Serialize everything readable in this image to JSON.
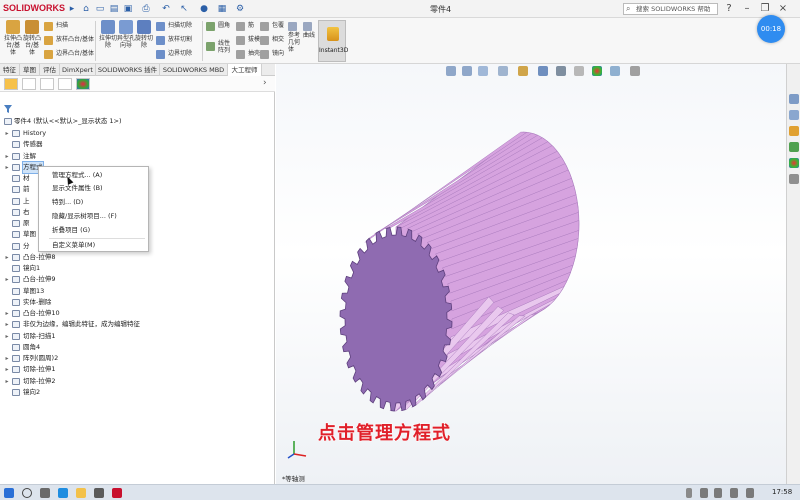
{
  "app": {
    "brand": "SOLIDWORKS",
    "doc_title": "零件4",
    "search_placeholder": "搜索 SOLIDWORKS 帮助"
  },
  "ribbon": {
    "big_buttons": [
      {
        "label": "拉伸凸台/基体",
        "color": "#d9a441"
      },
      {
        "label": "旋转凸台/基体",
        "color": "#c98f35"
      },
      {
        "label": "拉伸切除",
        "color": "#6d8fc9"
      },
      {
        "label": "异型孔向导",
        "color": "#7a9bd2"
      },
      {
        "label": "旋转切除",
        "color": "#5d7fbf"
      }
    ],
    "small_buttons": [
      {
        "label": "扫描",
        "color": "#d9a441"
      },
      {
        "label": "放样凸台/基体",
        "color": "#d9a441"
      },
      {
        "label": "边界凸台/基体",
        "color": "#d9a441"
      },
      {
        "label": "扫描切除",
        "color": "#6d8fc9"
      },
      {
        "label": "放样切割",
        "color": "#6d8fc9"
      },
      {
        "label": "边界切除",
        "color": "#6d8fc9"
      },
      {
        "label": "圆角",
        "color": "#7ca36d"
      },
      {
        "label": "线性阵列",
        "color": "#7ca36d"
      },
      {
        "label": "筋",
        "color": "#a0a0a0"
      },
      {
        "label": "拔模",
        "color": "#a0a0a0"
      },
      {
        "label": "抽壳",
        "color": "#a0a0a0"
      },
      {
        "label": "包覆",
        "color": "#a0a0a0"
      },
      {
        "label": "相交",
        "color": "#a0a0a0"
      },
      {
        "label": "镜向",
        "color": "#a0a0a0"
      },
      {
        "label": "参考几何体",
        "color": "#9aa7c0"
      },
      {
        "label": "曲线",
        "color": "#9aa7c0"
      }
    ],
    "instant3d": "Instant3D"
  },
  "timer": "00:18",
  "tabs": [
    "特征",
    "草图",
    "评估",
    "DimXpert",
    "SOLIDWORKS 插件",
    "SOLIDWORKS MBD",
    "大工程师"
  ],
  "tree": {
    "root": "零件4 (默认<<默认>_显示状态 1>)",
    "items": [
      {
        "label": "History",
        "exp": "▸"
      },
      {
        "label": "传感器",
        "exp": ""
      },
      {
        "label": "注解",
        "exp": "▸"
      },
      {
        "label": "方程式",
        "exp": "▸",
        "selected": true
      },
      {
        "label": "材",
        "exp": ""
      },
      {
        "label": "前",
        "exp": ""
      },
      {
        "label": "上",
        "exp": ""
      },
      {
        "label": "右",
        "exp": ""
      },
      {
        "label": "原",
        "exp": ""
      },
      {
        "label": "草图",
        "exp": ""
      },
      {
        "label": "分",
        "exp": ""
      },
      {
        "label": "凸台-拉伸8",
        "exp": "▸"
      },
      {
        "label": "镜向1",
        "exp": ""
      },
      {
        "label": "凸台-拉伸9",
        "exp": "▸"
      },
      {
        "label": "草图13",
        "exp": ""
      },
      {
        "label": "实体-删除",
        "exp": ""
      },
      {
        "label": "凸台-拉伸10",
        "exp": "▸"
      },
      {
        "label": "非仅为边缘，编辑此特征，成为编辑特征",
        "exp": "▸"
      },
      {
        "label": "切除-扫描1",
        "exp": "▸"
      },
      {
        "label": "圆角4",
        "exp": ""
      },
      {
        "label": "阵列(圆周)2",
        "exp": "▸"
      },
      {
        "label": "切除-拉伸1",
        "exp": "▸"
      },
      {
        "label": "切除-拉伸2",
        "exp": "▸"
      },
      {
        "label": "镜向2",
        "exp": ""
      }
    ]
  },
  "context_menu": {
    "items": [
      "管理方程式... (A)",
      "显示文件属性 (B)",
      "特到... (D)",
      "隐藏/显示树项目... (F)",
      "折叠项目 (G)",
      "自定义菜单(M)"
    ]
  },
  "viewport": {
    "view_label": "*等轴测",
    "caption": "点击管理方程式",
    "gear_colors": {
      "face": "#8f6bb1",
      "teeth_light": "#e9c8ee",
      "teeth_mid": "#d6a3df",
      "teeth_dark": "#a97bbd"
    }
  },
  "clock": "17:58"
}
